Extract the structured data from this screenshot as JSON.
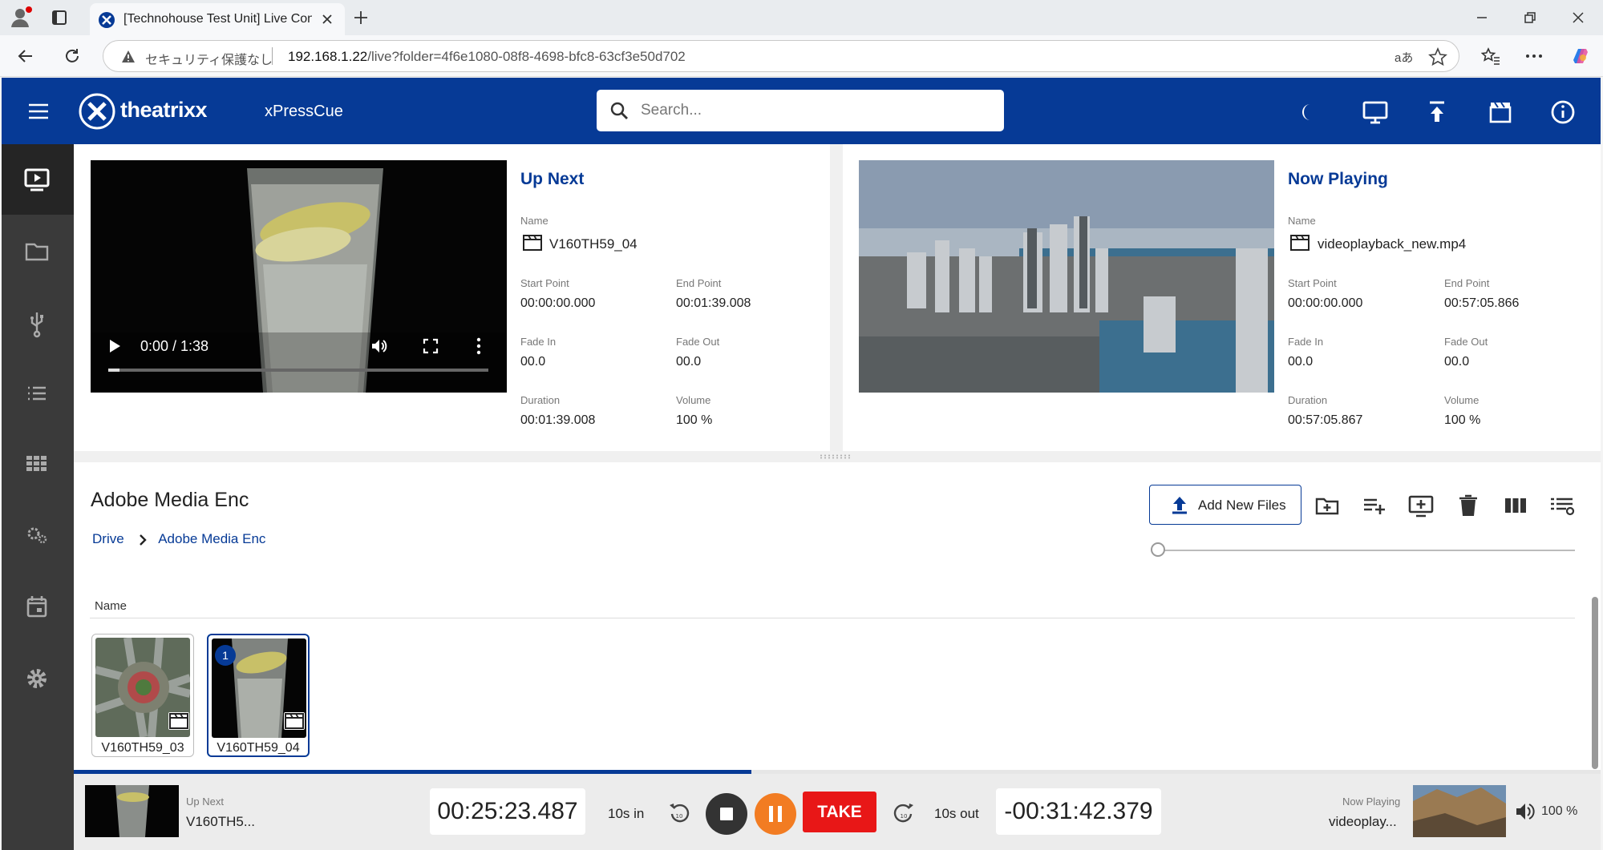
{
  "browser": {
    "tab_title": "[Technohouse Test Unit] Live Cont",
    "security_label": "セキュリティ保護なし",
    "url_host": "192.168.1.22",
    "url_path": "/live?folder=4f6e1080-08f8-4698-bfc8-63cf3e50d702",
    "reader_label": "aあ"
  },
  "header": {
    "logo_text": "theatrixx",
    "app_title": "xPressCue",
    "search_placeholder": "Search..."
  },
  "up_next": {
    "title": "Up Next",
    "player_time": "0:00 / 1:38",
    "name_label": "Name",
    "name": "V160TH59_04",
    "start_label": "Start Point",
    "start": "00:00:00.000",
    "end_label": "End Point",
    "end": "00:01:39.008",
    "fade_in_label": "Fade In",
    "fade_in": "00.0",
    "fade_out_label": "Fade Out",
    "fade_out": "00.0",
    "duration_label": "Duration",
    "duration": "00:01:39.008",
    "volume_label": "Volume",
    "volume": "100 %"
  },
  "now_playing": {
    "title": "Now Playing",
    "name_label": "Name",
    "name": "videoplayback_new.mp4",
    "start_label": "Start Point",
    "start": "00:00:00.000",
    "end_label": "End Point",
    "end": "00:57:05.866",
    "fade_in_label": "Fade In",
    "fade_in": "00.0",
    "fade_out_label": "Fade Out",
    "fade_out": "00.0",
    "duration_label": "Duration",
    "duration": "00:57:05.867",
    "volume_label": "Volume",
    "volume": "100 %"
  },
  "library": {
    "folder_title": "Adobe Media Enc",
    "breadcrumb": [
      "Drive",
      "Adobe Media Enc"
    ],
    "add_button": "Add New Files",
    "column_name": "Name",
    "files": [
      {
        "name": "V160TH59_03",
        "selected": false,
        "badge": ""
      },
      {
        "name": "V160TH59_04",
        "selected": true,
        "badge": "1"
      }
    ]
  },
  "transport": {
    "up_next_label": "Up Next",
    "up_next_name": "V160TH5...",
    "elapsed": "00:25:23.487",
    "skip_in": "10s in",
    "take": "TAKE",
    "skip_out": "10s out",
    "remaining": "-00:31:42.379",
    "now_playing_label": "Now Playing",
    "now_playing_name": "videoplay...",
    "volume": "100 %",
    "progress": 0.444
  },
  "colors": {
    "brand": "#063a96",
    "take": "#e81717",
    "pause": "#f27c22"
  }
}
